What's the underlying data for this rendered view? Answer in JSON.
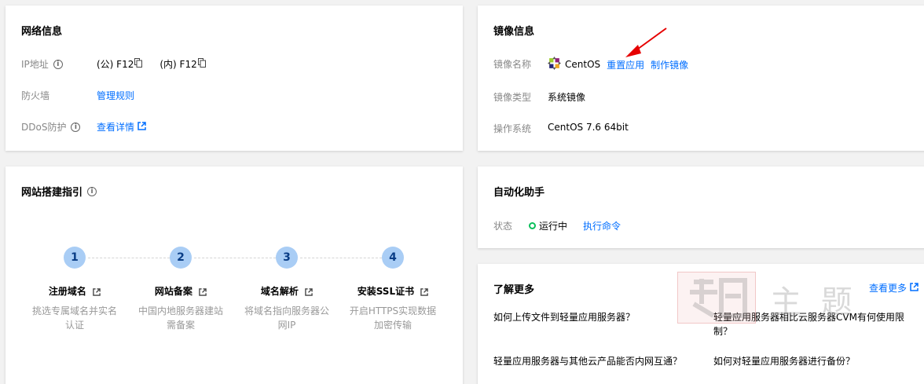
{
  "network": {
    "title": "网络信息",
    "ip_label": "IP地址",
    "ip_public": "(公) F12",
    "ip_private": "(内) F12",
    "firewall_label": "防火墙",
    "firewall_link": "管理规则",
    "ddos_label": "DDoS防护",
    "ddos_link": "查看详情"
  },
  "image": {
    "title": "镜像信息",
    "name_label": "镜像名称",
    "name_value": "CentOS",
    "reapply_link": "重置应用",
    "make_image_link": "制作镜像",
    "type_label": "镜像类型",
    "type_value": "系统镜像",
    "os_label": "操作系统",
    "os_value": "CentOS 7.6 64bit"
  },
  "guide": {
    "title": "网站搭建指引",
    "steps": [
      {
        "num": "1",
        "title": "注册域名",
        "desc": "挑选专属域名并实名认证"
      },
      {
        "num": "2",
        "title": "网站备案",
        "desc": "中国内地服务器建站需备案"
      },
      {
        "num": "3",
        "title": "域名解析",
        "desc": "将域名指向服务器公网IP"
      },
      {
        "num": "4",
        "title": "安装SSL证书",
        "desc": "开启HTTPS实现数据加密传输"
      }
    ]
  },
  "automation": {
    "title": "自动化助手",
    "status_label": "状态",
    "status_value": "运行中",
    "run_link": "执行命令"
  },
  "learn": {
    "title": "了解更多",
    "more_link": "查看更多",
    "faqs": [
      "如何上传文件到轻量应用服务器？",
      "轻量应用服务器相比云服务器CVM有何使用限制？",
      "轻量应用服务器与其他云产品能否内网互通？",
      "如何对轻量应用服务器进行备份？"
    ]
  },
  "watermark": {
    "text": "主 题"
  },
  "colors": {
    "link": "#006eff",
    "status_ok": "#0abf5b",
    "step_circle": "#a9cdf5",
    "annotation_arrow": "#e60000"
  }
}
